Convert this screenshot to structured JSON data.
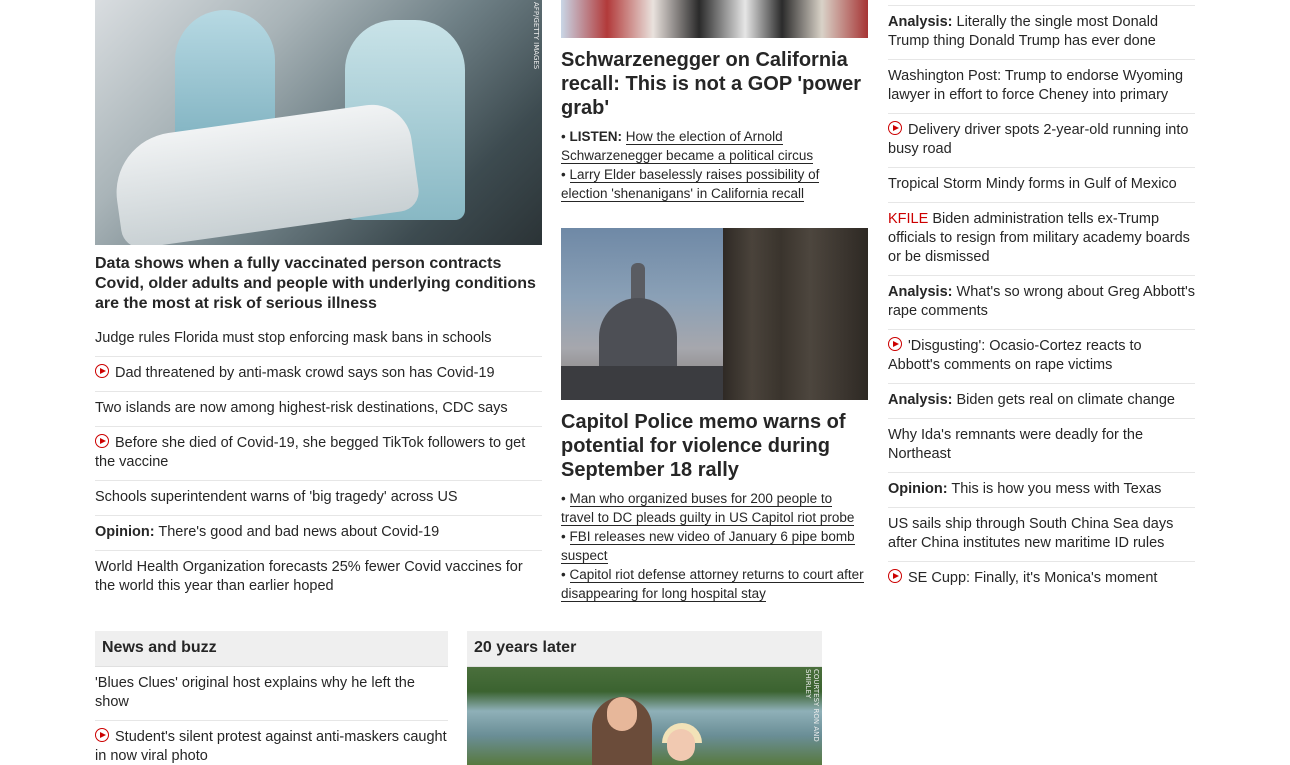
{
  "left": {
    "hero_credit": "AFP/GETTY IMAGES",
    "hero_headline": "Data shows when a fully vaccinated person contracts Covid, older adults and people with underlying conditions are the most at risk of serious illness",
    "items": [
      {
        "label": "",
        "text": "Judge rules Florida must stop enforcing mask bans in schools",
        "video": false
      },
      {
        "label": "",
        "text": "Dad threatened by anti-mask crowd says son has Covid-19",
        "video": true
      },
      {
        "label": "",
        "text": "Two islands are now among highest-risk destinations, CDC says",
        "video": false
      },
      {
        "label": "",
        "text": "Before she died of Covid-19, she begged TikTok followers to get the vaccine",
        "video": true
      },
      {
        "label": "",
        "text": "Schools superintendent warns of 'big tragedy' across US",
        "video": false
      },
      {
        "label": "Opinion:",
        "text": "There's good and bad news about Covid-19",
        "video": false
      },
      {
        "label": "",
        "text": "World Health Organization forecasts 25% fewer Covid vaccines for the world this year than earlier hoped",
        "video": false
      }
    ]
  },
  "mid": {
    "story1": {
      "headline": "Schwarzenegger on California recall: This is not a GOP 'power grab'",
      "links": [
        {
          "prefix": "LISTEN:",
          "text": "How the election of Arnold Schwarzenegger became a political circus"
        },
        {
          "prefix": "",
          "text": "Larry Elder baselessly raises possibility of election 'shenanigans' in California recall"
        }
      ]
    },
    "story2": {
      "headline": "Capitol Police memo warns of potential for violence during September 18 rally",
      "links": [
        {
          "prefix": "",
          "text": "Man who organized buses for 200 people to travel to DC pleads guilty in US Capitol riot probe"
        },
        {
          "prefix": "",
          "text": "FBI releases new video of January 6 pipe bomb suspect"
        },
        {
          "prefix": "",
          "text": "Capitol riot defense attorney returns to court after disappearing for long hospital stay"
        }
      ]
    },
    "bullet": "•"
  },
  "right": {
    "items": [
      {
        "label": "Analysis:",
        "kfile": "",
        "text": "Literally the single most Donald Trump thing Donald Trump has ever done",
        "video": false
      },
      {
        "label": "",
        "kfile": "",
        "text": "Washington Post: Trump to endorse Wyoming lawyer in effort to force Cheney into primary",
        "video": false
      },
      {
        "label": "",
        "kfile": "",
        "text": "Delivery driver spots 2-year-old running into busy road",
        "video": true
      },
      {
        "label": "",
        "kfile": "",
        "text": "Tropical Storm Mindy forms in Gulf of Mexico",
        "video": false
      },
      {
        "label": "",
        "kfile": "KFILE",
        "text": "Biden administration tells ex-Trump officials to resign from military academy boards or be dismissed",
        "video": false
      },
      {
        "label": "Analysis:",
        "kfile": "",
        "text": "What's so wrong about Greg Abbott's rape comments",
        "video": false
      },
      {
        "label": "",
        "kfile": "",
        "text": "'Disgusting': Ocasio-Cortez reacts to Abbott's comments on rape victims",
        "video": true
      },
      {
        "label": "Analysis:",
        "kfile": "",
        "text": "Biden gets real on climate change",
        "video": false
      },
      {
        "label": "",
        "kfile": "",
        "text": "Why Ida's remnants were deadly for the Northeast",
        "video": false
      },
      {
        "label": "Opinion:",
        "kfile": "",
        "text": "This is how you mess with Texas",
        "video": false
      },
      {
        "label": "",
        "kfile": "",
        "text": "US sails ship through South China Sea days after China institutes new maritime ID rules",
        "video": false
      },
      {
        "label": "",
        "kfile": "",
        "text": "SE Cupp: Finally, it's Monica's moment",
        "video": true
      }
    ]
  },
  "bottom": {
    "news_title": "News and buzz",
    "news_items": [
      {
        "text": "'Blues Clues' original host explains why he left the show",
        "video": false
      },
      {
        "text": "Student's silent protest against anti-maskers caught in now viral photo",
        "video": true
      }
    ],
    "years_title": "20 years later",
    "years_credit": "COURTESY RON AND SHIRLEY"
  },
  "colors": {
    "accent": "#cc0000",
    "text": "#262626",
    "divider": "#e6e6e6",
    "box_bg": "#efefef"
  }
}
